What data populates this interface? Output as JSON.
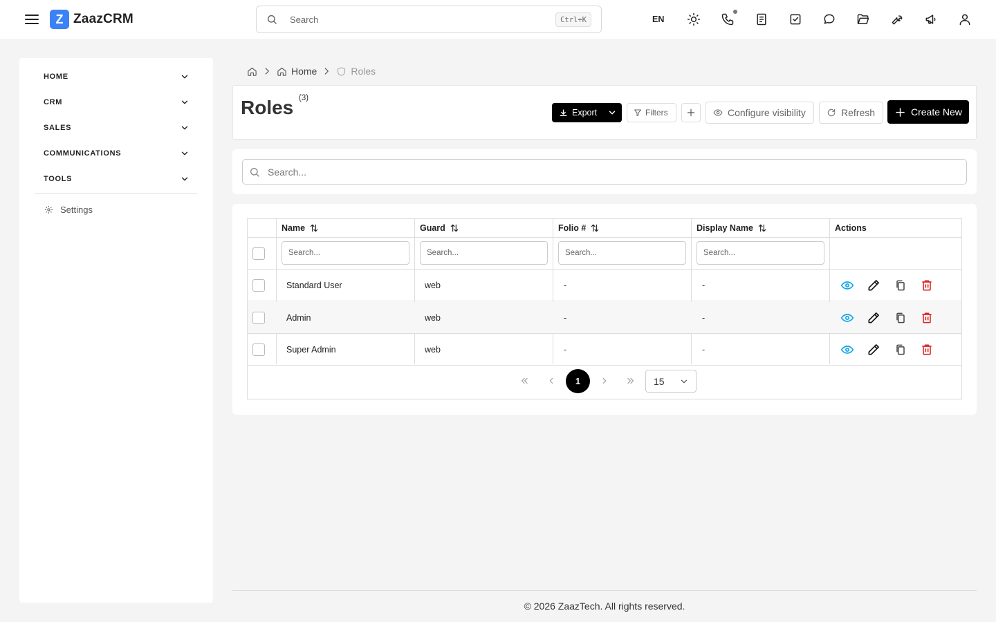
{
  "app": {
    "logo_letter": "Z",
    "name": "ZaazCRM",
    "brand_color": "#3b82f6"
  },
  "topbar": {
    "search_placeholder": "Search",
    "search_shortcut": "Ctrl+K",
    "language": "EN",
    "icons": [
      "sun-icon",
      "phone-icon",
      "document-icon",
      "checkbox-icon",
      "chat-icon",
      "folder-icon",
      "wrench-icon",
      "megaphone-icon",
      "user-icon"
    ]
  },
  "sidebar": {
    "items": [
      {
        "label": "HOME"
      },
      {
        "label": "CRM"
      },
      {
        "label": "SALES"
      },
      {
        "label": "COMMUNICATIONS"
      },
      {
        "label": "TOOLS"
      }
    ],
    "settings_label": "Settings"
  },
  "breadcrumb": {
    "home_label": "Home",
    "current_label": "Roles"
  },
  "page": {
    "title": "Roles",
    "count": "(3)"
  },
  "toolbar": {
    "export_label": "Export",
    "filters_label": "Filters",
    "configure_visibility_label": "Configure visibility",
    "refresh_label": "Refresh",
    "create_label": "Create New"
  },
  "search": {
    "placeholder": "Search..."
  },
  "table": {
    "columns": [
      {
        "label": "Name",
        "sortable": true
      },
      {
        "label": "Guard",
        "sortable": true
      },
      {
        "label": "Folio #",
        "sortable": true
      },
      {
        "label": "Display Name",
        "sortable": true
      },
      {
        "label": "Actions",
        "sortable": false
      }
    ],
    "column_search_placeholder": "Search...",
    "rows": [
      {
        "name": "Standard User",
        "guard": "web",
        "folio": "-",
        "display_name": "-"
      },
      {
        "name": "Admin",
        "guard": "web",
        "folio": "-",
        "display_name": "-"
      },
      {
        "name": "Super Admin",
        "guard": "web",
        "folio": "-",
        "display_name": "-"
      }
    ],
    "action_colors": {
      "view": "#0ea5e9",
      "edit": "#111111",
      "copy": "#444444",
      "delete": "#dc2626"
    }
  },
  "pagination": {
    "current_page": "1",
    "page_size": "15"
  },
  "footer": {
    "text": "© 2026 ZaazTech. All rights reserved."
  }
}
